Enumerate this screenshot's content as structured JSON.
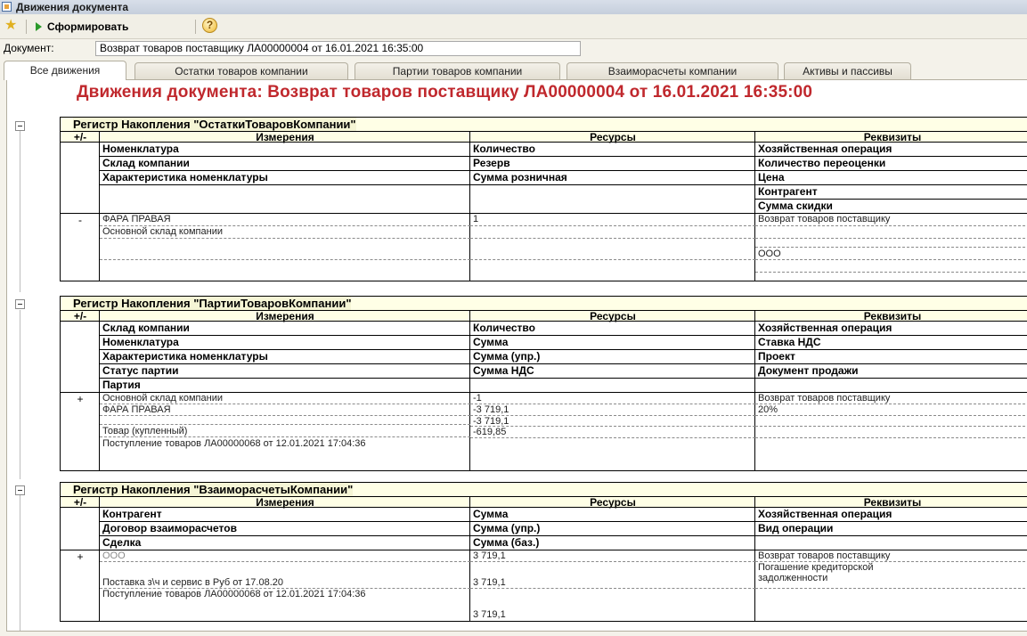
{
  "window": {
    "title": "Движения документа"
  },
  "toolbar": {
    "run_label": "Сформировать",
    "help_label": "?"
  },
  "document": {
    "label": "Документ:",
    "value": "Возврат товаров поставщику ЛА00000004 от 16.01.2021 16:35:00"
  },
  "tabs": [
    {
      "label": "Все движения",
      "active": true
    },
    {
      "label": "Остатки товаров компании",
      "active": false
    },
    {
      "label": "Партии товаров компании",
      "active": false
    },
    {
      "label": "Взаиморасчеты компании",
      "active": false
    },
    {
      "label": "Активы и пассивы",
      "active": false
    }
  ],
  "heading": "Движения документа: Возврат товаров поставщику ЛА00000004 от 16.01.2021 16:35:00",
  "columns": {
    "pm": "+/-",
    "dim": "Измерения",
    "res": "Ресурсы",
    "req": "Реквизиты"
  },
  "registers": [
    {
      "title": "Регистр Накопления \"ОстаткиТоваровКомпании\"",
      "sign": "-",
      "header_dims": [
        "Номенклатура",
        "Склад компании",
        "Характеристика номенклатуры"
      ],
      "header_res": [
        "Количество",
        "Резерв",
        "Сумма розничная"
      ],
      "header_req": [
        "Хозяйственная операция",
        "Количество переоценки",
        "Цена",
        "Контрагент",
        "Сумма скидки"
      ],
      "data_dims": [
        "ФАРА ПРАВАЯ",
        "Основной склад компании",
        ""
      ],
      "data_res": [
        "1",
        "",
        ""
      ],
      "data_req": [
        "Возврат товаров поставщику",
        "",
        "",
        "ООО",
        ""
      ]
    },
    {
      "title": "Регистр Накопления \"ПартииТоваровКомпании\"",
      "sign": "+",
      "header_dims": [
        "Склад компании",
        "Номенклатура",
        "Характеристика номенклатуры",
        "Статус партии",
        "Партия"
      ],
      "header_res": [
        "Количество",
        "Сумма",
        "Сумма (упр.)",
        "Сумма НДС"
      ],
      "header_req": [
        "Хозяйственная операция",
        "Ставка НДС",
        "Проект",
        "Документ продажи"
      ],
      "data_dims": [
        "Основной склад компании",
        "ФАРА ПРАВАЯ",
        "",
        "Товар (купленный)",
        "Поступление товаров ЛА00000068 от 12.01.2021 17:04:36"
      ],
      "data_res": [
        "-1",
        "-3 719,1",
        "-3 719,1",
        "-619,85",
        ""
      ],
      "data_req": [
        "Возврат товаров поставщику",
        "20%",
        "",
        "",
        ""
      ]
    },
    {
      "title": "Регистр Накопления \"ВзаиморасчетыКомпании\"",
      "sign": "+",
      "header_dims": [
        "Контрагент",
        "Договор взаиморасчетов",
        "Сделка"
      ],
      "header_res": [
        "Сумма",
        "Сумма (упр.)",
        "Сумма (баз.)"
      ],
      "header_req": [
        "Хозяйственная операция",
        "Вид операции"
      ],
      "data_dims": [
        "ООО",
        "Поставка з\\ч и сервис в Руб от 17.08.20",
        "Поступление товаров ЛА00000068 от 12.01.2021 17:04:36"
      ],
      "data_res": [
        "3 719,1",
        "3 719,1",
        "3 719,1"
      ],
      "data_req": [
        "Возврат товаров поставщику",
        "Погашение кредиторской задолженности",
        ""
      ]
    }
  ]
}
